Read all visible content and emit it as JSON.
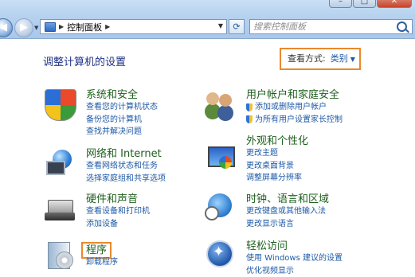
{
  "window": {
    "minimize_glyph": "–",
    "maximize_glyph": "□",
    "close_glyph": "✕"
  },
  "nav": {
    "back_glyph": "◀",
    "forward_glyph": "▶",
    "breadcrumb_arrow": "▶",
    "address_text": "控制面板",
    "address_arrow": "▶",
    "dropdown_glyph": "▼",
    "refresh_glyph": "⟳"
  },
  "search": {
    "placeholder": "搜索控制面板"
  },
  "content": {
    "page_title": "调整计算机的设置",
    "view_by_label": "查看方式:",
    "view_by_value": "类别",
    "view_by_arrow": "▼"
  },
  "categories": [
    {
      "title": "系统和安全",
      "icon": "shield-icon",
      "links": [
        "查看您的计算机状态",
        "备份您的计算机",
        "查找并解决问题"
      ]
    },
    {
      "title": "用户帐户和家庭安全",
      "icon": "users-icon",
      "links": [
        "添加或删除用户帐户",
        "为所有用户设置家长控制"
      ]
    },
    {
      "title": "网络和 Internet",
      "icon": "network-icon",
      "links": [
        "查看网络状态和任务",
        "选择家庭组和共享选项"
      ]
    },
    {
      "title": "外观和个性化",
      "icon": "appearance-icon",
      "links": [
        "更改主题",
        "更改桌面背景",
        "调整屏幕分辨率"
      ]
    },
    {
      "title": "硬件和声音",
      "icon": "printer-icon",
      "links": [
        "查看设备和打印机",
        "添加设备"
      ]
    },
    {
      "title": "时钟、语言和区域",
      "icon": "clock-globe-icon",
      "links": [
        "更改键盘或其他输入法",
        "更改显示语言"
      ]
    },
    {
      "title": "程序",
      "icon": "programs-icon",
      "links": [
        "卸载程序"
      ]
    },
    {
      "title": "轻松访问",
      "icon": "accessibility-icon",
      "links": [
        "使用 Windows 建议的设置",
        "优化视频显示"
      ]
    }
  ]
}
